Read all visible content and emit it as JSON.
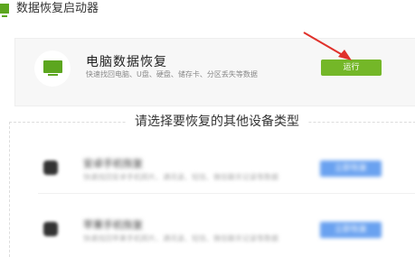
{
  "app": {
    "title": "数据恢复启动器"
  },
  "pc_recovery": {
    "title": "电脑数据恢复",
    "description": "快速找回电脑、U盘、硬盘、储存卡、分区丢失等数据",
    "run_label": "运行",
    "accent": "#74b728"
  },
  "other_devices": {
    "section_title": "请选择要恢复的其他设备类型",
    "items": [
      {
        "icon": "android-icon",
        "title": "安卓手机恢复",
        "description": "快速找回安卓手机照片、通讯录、短信、微信聊天记录等数据",
        "button_label": "立即恢复"
      },
      {
        "icon": "apple-icon",
        "title": "苹果手机恢复",
        "description": "快速找回苹果手机照片、通讯录、短信、微信聊天记录等数据",
        "button_label": "立即恢复"
      }
    ],
    "button_color": "#6aa2f0"
  }
}
